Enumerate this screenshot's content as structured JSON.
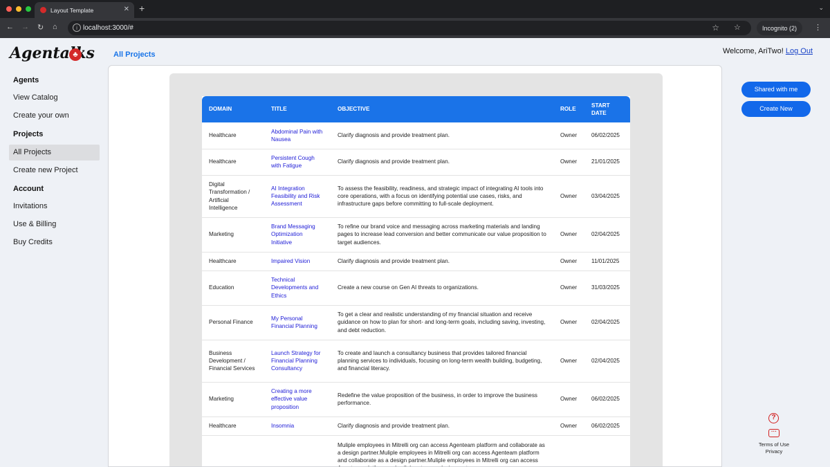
{
  "browser": {
    "tab_title": "Layout Template",
    "url": "localhost:3000/#",
    "incognito_label": "Incognito (2)"
  },
  "app": {
    "logo_text": "Agentalks",
    "page_title": "All Projects",
    "welcome_text": "Welcome, AriTwo!",
    "logout_label": "Log Out"
  },
  "sidebar": {
    "agents_heading": "Agents",
    "view_catalog": "View Catalog",
    "create_your_own": "Create your own",
    "projects_heading": "Projects",
    "all_projects": "All Projects",
    "create_new_project": "Create new Project",
    "account_heading": "Account",
    "invitations": "Invitations",
    "use_billing": "Use & Billing",
    "buy_credits": "Buy Credits"
  },
  "table": {
    "headers": [
      "DOMAIN",
      "TITLE",
      "OBJECTIVE",
      "ROLE",
      "START DATE"
    ],
    "rows": [
      {
        "domain": "Healthcare",
        "title": "Abdominal Pain with Nausea",
        "objective": "Clarify diagnosis and provide treatment plan.",
        "role": "Owner",
        "date": "06/02/2025"
      },
      {
        "domain": "Healthcare",
        "title": "Persistent Cough with Fatigue",
        "objective": "Clarify diagnosis and provide treatment plan.",
        "role": "Owner",
        "date": "21/01/2025"
      },
      {
        "domain": "Digital Transformation / Artificial Intelligence",
        "title": "AI Integration Feasibility and Risk Assessment",
        "objective": "To assess the feasibility, readiness, and strategic impact of integrating AI tools into core operations, with a focus on identifying potential use cases, risks, and infrastructure gaps before committing to full-scale deployment.",
        "role": "Owner",
        "date": "03/04/2025"
      },
      {
        "domain": "Marketing",
        "title": "Brand Messaging Optimization Initiative",
        "objective": "To refine our brand voice and messaging across marketing materials and landing pages to increase lead conversion and better communicate our value proposition to target audiences.",
        "role": "Owner",
        "date": "02/04/2025"
      },
      {
        "domain": "Healthcare",
        "title": "Impaired Vision",
        "objective": "Clarify diagnosis and provide treatment plan.",
        "role": "Owner",
        "date": "11/01/2025"
      },
      {
        "domain": "Education",
        "title": "Technical Developments and Ethics",
        "objective": "Create a new course on Gen AI threats to organizations.",
        "role": "Owner",
        "date": "31/03/2025"
      },
      {
        "domain": "Personal Finance",
        "title": "My Personal Financial Planning",
        "objective": "To get a clear and realistic understanding of my financial situation and receive guidance on how to plan for short- and long-term goals, including saving, investing, and debt reduction.",
        "role": "Owner",
        "date": "02/04/2025"
      },
      {
        "domain": "Business Development / Financial Services",
        "title": "Launch Strategy for Financial Planning Consultancy",
        "objective": "To create and launch a consultancy business that provides tailored financial planning services to individuals, focusing on long-term wealth building, budgeting, and financial literacy.",
        "role": "Owner",
        "date": "02/04/2025"
      },
      {
        "domain": "Marketing",
        "title": "Creating a more effective value proposition",
        "objective": "Redefine the value proposition of the business, in order to improve the business performance.",
        "role": "Owner",
        "date": "06/02/2025"
      },
      {
        "domain": "Healthcare",
        "title": "Insomnia",
        "objective": "Clarify diagnosis and provide treatment plan.",
        "role": "Owner",
        "date": "06/02/2025"
      },
      {
        "domain": "",
        "title": "",
        "objective": "Muliple employees in Mitrelli org can access Agenteam platform and collaborate as a design partner.Muliple employees in Mitrelli org can access Agenteam platform and collaborate as a design partner.Muliple employees in Mitrelli org can access Agenteam platform and collaborate as a design partner.",
        "role": "",
        "date": ""
      }
    ]
  },
  "actions": {
    "shared_with_me": "Shared with me",
    "create_new": "Create New"
  },
  "footer": {
    "terms": "Terms of Use",
    "privacy": "Privacy"
  }
}
